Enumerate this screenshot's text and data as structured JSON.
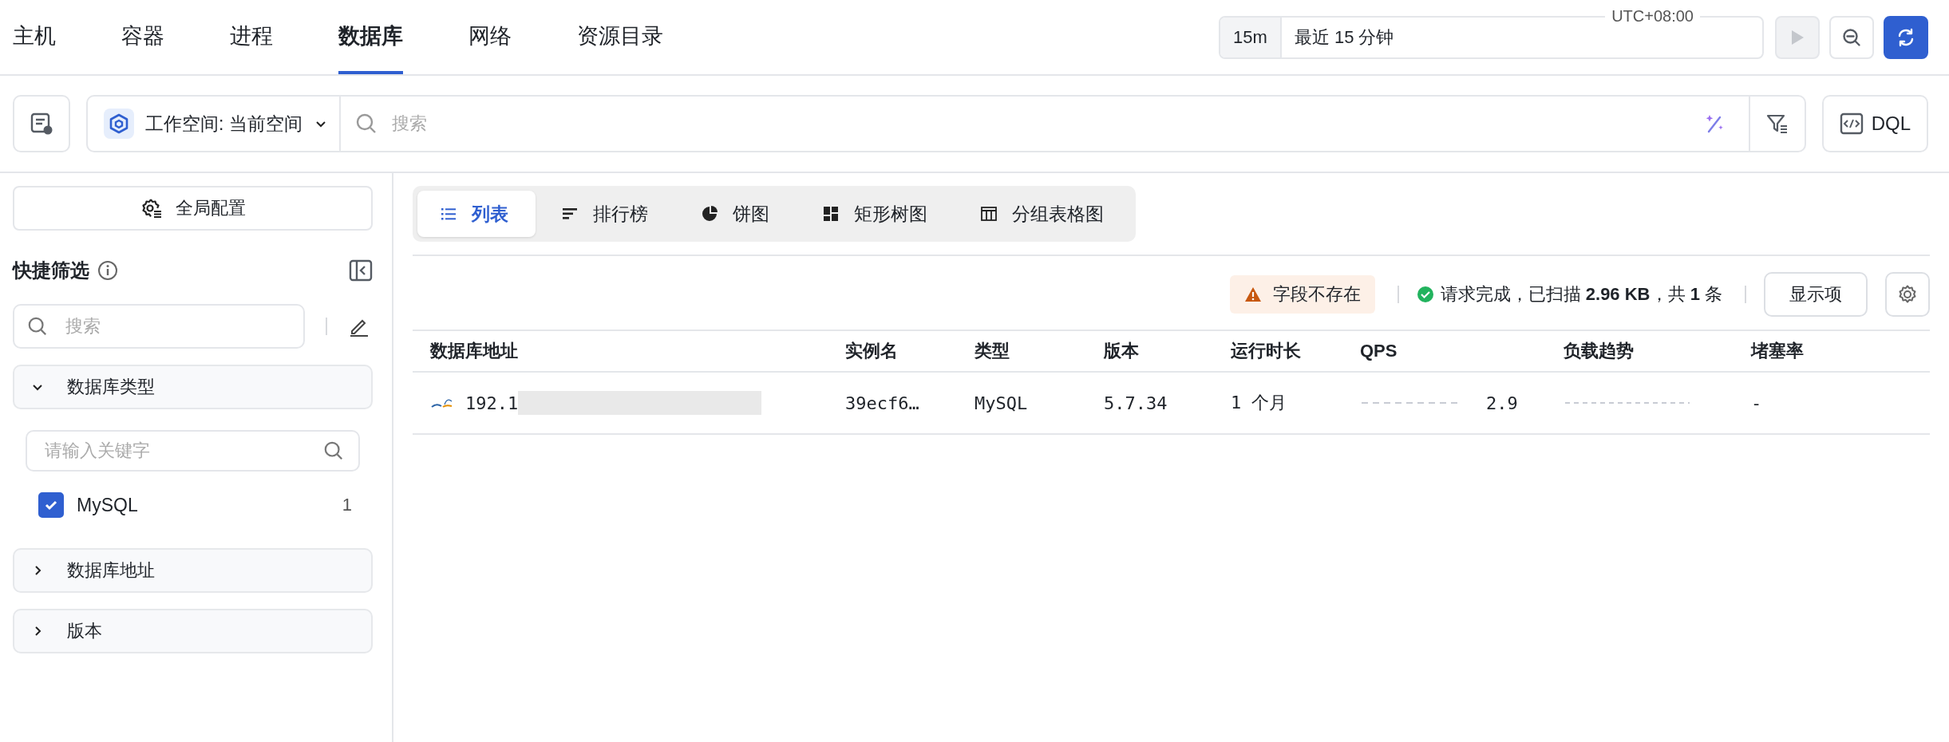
{
  "nav": {
    "tabs": [
      {
        "label": "主机",
        "selected": false
      },
      {
        "label": "容器",
        "selected": false
      },
      {
        "label": "进程",
        "selected": false
      },
      {
        "label": "数据库",
        "selected": true
      },
      {
        "label": "网络",
        "selected": false
      },
      {
        "label": "资源目录",
        "selected": false
      }
    ]
  },
  "time_range": {
    "badge": "15m",
    "label": "最近 15 分钟",
    "timezone": "UTC+08:00"
  },
  "toolbar": {
    "workspace": "工作空间: 当前空间",
    "search": {
      "placeholder": "搜索"
    },
    "dql": "DQL"
  },
  "sidebar": {
    "global_config": "全局配置",
    "title": "快捷筛选",
    "search": {
      "placeholder": "搜索"
    },
    "groups": [
      {
        "label": "数据库类型",
        "expanded": true,
        "search": {
          "placeholder": "请输入关键字"
        },
        "options": [
          {
            "label": "MySQL",
            "count": "1",
            "checked": true
          }
        ]
      },
      {
        "label": "数据库地址",
        "expanded": false
      },
      {
        "label": "版本",
        "expanded": false
      }
    ]
  },
  "view_tabs": [
    {
      "label": "列表",
      "kind": "list",
      "selected": true
    },
    {
      "label": "排行榜",
      "kind": "rank",
      "selected": false
    },
    {
      "label": "饼图",
      "kind": "pie",
      "selected": false
    },
    {
      "label": "矩形树图",
      "kind": "treemap",
      "selected": false
    },
    {
      "label": "分组表格图",
      "kind": "grouptable",
      "selected": false
    }
  ],
  "status": {
    "warning": "字段不存在",
    "message": "请求完成，已扫描 **2.96 KB**，共 **1** 条",
    "display_button": "显示项"
  },
  "table": {
    "columns": [
      "数据库地址",
      "实例名",
      "类型",
      "版本",
      "运行时长",
      "QPS",
      "负载趋势",
      "堵塞率"
    ],
    "rows": [
      {
        "cells": [
          {
            "kind": "address",
            "text": "192.1"
          },
          {
            "kind": "text",
            "text": "39ecf6…"
          },
          {
            "kind": "text",
            "text": "MySQL"
          },
          {
            "kind": "text",
            "text": "5.7.34"
          },
          {
            "kind": "text",
            "text": "1 个月"
          },
          {
            "kind": "trend_value",
            "text": "2.9"
          },
          {
            "kind": "trend"
          },
          {
            "kind": "text",
            "text": "-"
          }
        ]
      }
    ]
  }
}
